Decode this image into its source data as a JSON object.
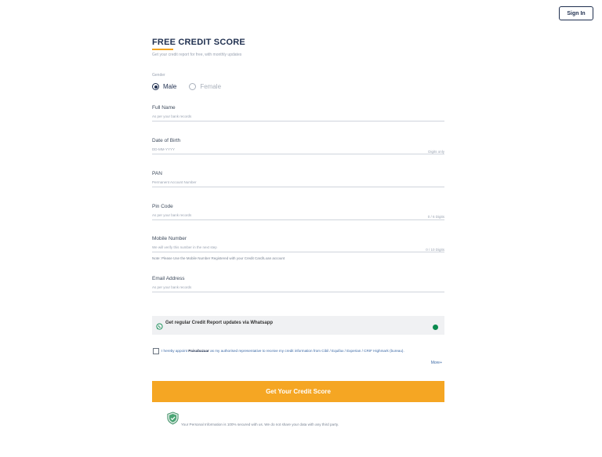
{
  "header": {
    "signin_label": "Sign In"
  },
  "form": {
    "title": "FREE CREDIT SCORE",
    "subtitle": "Get your credit report for free, with monthly updates",
    "gender": {
      "label": "Gender",
      "options": [
        "Male",
        "Female"
      ],
      "selected": "Male"
    },
    "full_name": {
      "label": "Full Name",
      "placeholder": "As per your bank records"
    },
    "dob": {
      "label": "Date of Birth",
      "placeholder": "DD-MM-YYYY",
      "hint": "Digits only"
    },
    "pan": {
      "label": "PAN",
      "placeholder": "Permanent Account Number"
    },
    "pin": {
      "label": "Pin Code",
      "placeholder": "As per your bank records",
      "hint": "0 / 6 Digits"
    },
    "mobile": {
      "label": "Mobile Number",
      "placeholder": "We will verify this number in the next step",
      "hint": "0 / 10 Digits",
      "note": "Note: Please Use the Mobile Number Registered with your Credit Card/Loan account"
    },
    "email": {
      "label": "Email Address",
      "placeholder": "As per your bank records"
    },
    "whatsapp": {
      "label": "Get regular Credit Report updates via Whatsapp"
    },
    "consent": {
      "prefix": "I hereby appoint ",
      "brand": "Paisabazaar",
      "suffix": " as my authorised representative to receive my credit information from Cibil / Equifax / Experian / CRIF Highmark (bureau).",
      "more": "More+"
    },
    "cta_label": "Get Your Credit Score",
    "secure_text": "Your Personal Information is 100% secured with us. We do not share your data with any third party."
  },
  "colors": {
    "brand": "#1f2f4f",
    "accent": "#f5a623",
    "whatsapp": "#0a8a4e"
  }
}
